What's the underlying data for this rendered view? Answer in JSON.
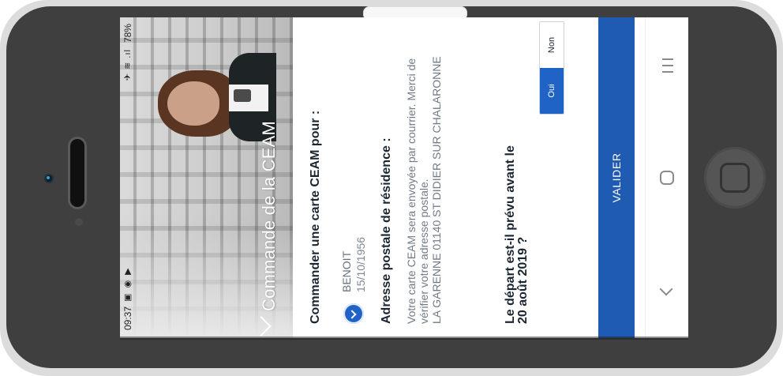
{
  "colors": {
    "primary": "#1f63c7",
    "button": "#1f5ab3",
    "phone_body": "#3f3f3f"
  },
  "status": {
    "time": "09:37",
    "left_icons": "▣ ◉ ▶",
    "right_icons": "✈ ≋ .ıl",
    "battery": "78%"
  },
  "hero": {
    "title": "Commande de la CEAM"
  },
  "form": {
    "person_heading": "Commander une carte CEAM pour :",
    "selected_person": {
      "name": "BENOIT",
      "date": "15/10/1956"
    },
    "address_heading": "Adresse postale de résidence :",
    "address_text": "Votre carte CEAM sera envoyée par courrier. Merci de vérifier votre adresse postale.\nLA GARENNE 01140 ST DIDIER SUR CHALARONNE",
    "departure_question": "Le départ est-il prévu avant le 20 août 2019 ?",
    "toggle": {
      "yes": "Oui",
      "no": "Non",
      "selected": "Oui"
    },
    "submit_label": "VALIDER"
  },
  "system_nav": {
    "back_icon": "chevron-left-icon",
    "home_icon": "square-home-icon",
    "recent_icon": "recent-apps-icon"
  }
}
